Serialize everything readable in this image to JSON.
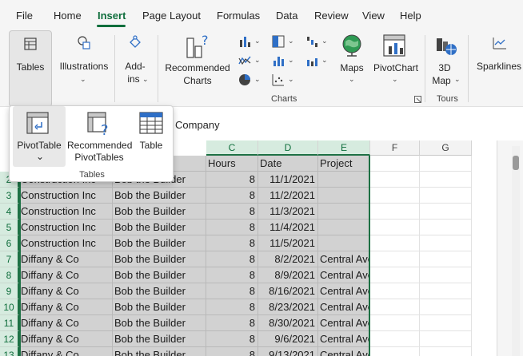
{
  "menu": {
    "items": [
      {
        "label": "File",
        "active": false
      },
      {
        "label": "Home",
        "active": false
      },
      {
        "label": "Insert",
        "active": true
      },
      {
        "label": "Page Layout",
        "active": false
      },
      {
        "label": "Formulas",
        "active": false
      },
      {
        "label": "Data",
        "active": false
      },
      {
        "label": "Review",
        "active": false
      },
      {
        "label": "View",
        "active": false
      },
      {
        "label": "Help",
        "active": false
      }
    ]
  },
  "ribbon": {
    "tables": {
      "label": "Tables",
      "icon": "table-icon"
    },
    "illustrations": {
      "label": "Illustrations",
      "icon": "shapes-icon"
    },
    "addins": {
      "label1": "Add-",
      "label2": "ins",
      "icon": "addins-icon"
    },
    "recommended_charts": {
      "label1": "Recommended",
      "label2": "Charts",
      "icon": "recommended-charts-icon"
    },
    "maps": {
      "label": "Maps",
      "icon": "globe-icon"
    },
    "pivotchart": {
      "label": "PivotChart",
      "icon": "pivotchart-icon"
    },
    "map3d": {
      "label1": "3D",
      "label2": "Map",
      "icon": "3d-map-icon"
    },
    "sparklines": {
      "label": "Sparklines",
      "icon": "sparkline-icon"
    },
    "groups": {
      "charts": "Charts",
      "tours": "Tours"
    }
  },
  "formula_bar": {
    "value": "Company"
  },
  "tables_dropdown": {
    "items": [
      {
        "label": "PivotTable",
        "icon": "pivottable-icon"
      },
      {
        "label1": "Recommended",
        "label2": "PivotTables",
        "icon": "recommended-pivottables-icon"
      },
      {
        "label": "Table",
        "icon": "table-grid-icon"
      }
    ],
    "group_label": "Tables"
  },
  "grid": {
    "columns": [
      "C",
      "D",
      "E",
      "F",
      "G"
    ],
    "header_row": {
      "c": "Hours",
      "d": "Date",
      "e": "Project"
    },
    "rows": [
      {
        "num": "2",
        "a": "Construction Inc",
        "b": "Bob the Builder",
        "c": "8",
        "d": "11/1/2021",
        "e": ""
      },
      {
        "num": "3",
        "a": "Construction Inc",
        "b": "Bob the Builder",
        "c": "8",
        "d": "11/2/2021",
        "e": ""
      },
      {
        "num": "4",
        "a": "Construction Inc",
        "b": "Bob the Builder",
        "c": "8",
        "d": "11/3/2021",
        "e": ""
      },
      {
        "num": "5",
        "a": "Construction Inc",
        "b": "Bob the Builder",
        "c": "8",
        "d": "11/4/2021",
        "e": ""
      },
      {
        "num": "6",
        "a": "Construction Inc",
        "b": "Bob the Builder",
        "c": "8",
        "d": "11/5/2021",
        "e": ""
      },
      {
        "num": "7",
        "a": "Diffany & Co",
        "b": "Bob the Builder",
        "c": "8",
        "d": "8/2/2021",
        "e": "Central Avenue store"
      },
      {
        "num": "8",
        "a": "Diffany & Co",
        "b": "Bob the Builder",
        "c": "8",
        "d": "8/9/2021",
        "e": "Central Avenue store"
      },
      {
        "num": "9",
        "a": "Diffany & Co",
        "b": "Bob the Builder",
        "c": "8",
        "d": "8/16/2021",
        "e": "Central Avenue store"
      },
      {
        "num": "10",
        "a": "Diffany & Co",
        "b": "Bob the Builder",
        "c": "8",
        "d": "8/23/2021",
        "e": "Central Avenue store"
      },
      {
        "num": "11",
        "a": "Diffany & Co",
        "b": "Bob the Builder",
        "c": "8",
        "d": "8/30/2021",
        "e": "Central Avenue store"
      },
      {
        "num": "12",
        "a": "Diffany & Co",
        "b": "Bob the Builder",
        "c": "8",
        "d": "9/6/2021",
        "e": "Central Avenue store"
      },
      {
        "num": "13",
        "a": "Diffany & Co",
        "b": "Bob the Builder",
        "c": "8",
        "d": "9/13/2021",
        "e": "Central Avenue store"
      }
    ]
  },
  "colors": {
    "accent": "#0f6e3c",
    "selection": "#d2d2d2"
  }
}
